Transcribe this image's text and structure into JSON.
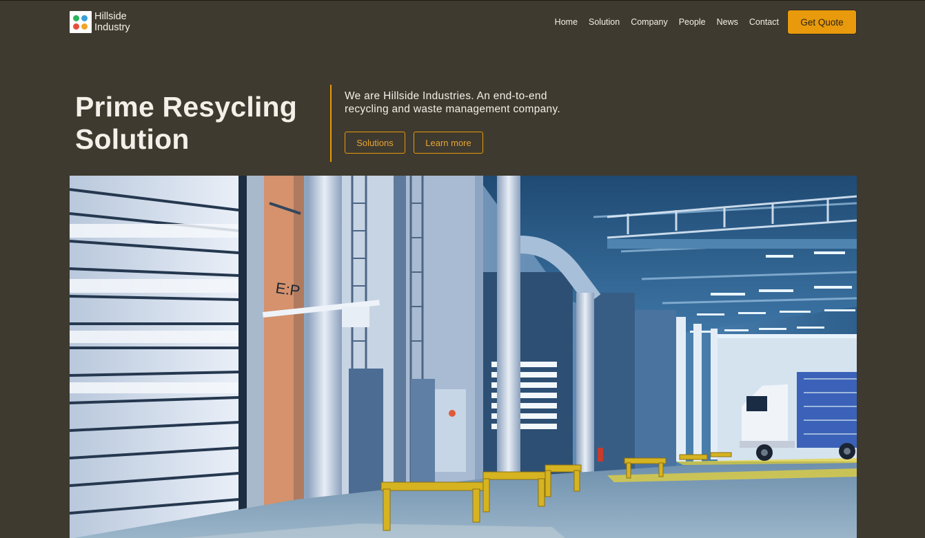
{
  "brand": {
    "name_line1": "Hillside",
    "name_line2": "Industry",
    "logo_dots": [
      "#2cb35d",
      "#3aa0d8",
      "#e8503a",
      "#f0a527"
    ]
  },
  "nav": {
    "items": [
      "Home",
      "Solution",
      "Company",
      "People",
      "News",
      "Contact"
    ],
    "cta_label": "Get Quote"
  },
  "hero": {
    "title_line1": "Prime Resycling",
    "title_line2": "Solution",
    "desc_line1": "We are Hillside Industries. An end-to-end",
    "desc_line2": "recycling and waste management company.",
    "btn_solutions": "Solutions",
    "btn_learn": "Learn more",
    "image_sign": "E:P"
  },
  "colors": {
    "background": "#3f3a2f",
    "accent": "#e89a0c",
    "accent_text": "#e8a533",
    "text": "#f3f0ea"
  }
}
